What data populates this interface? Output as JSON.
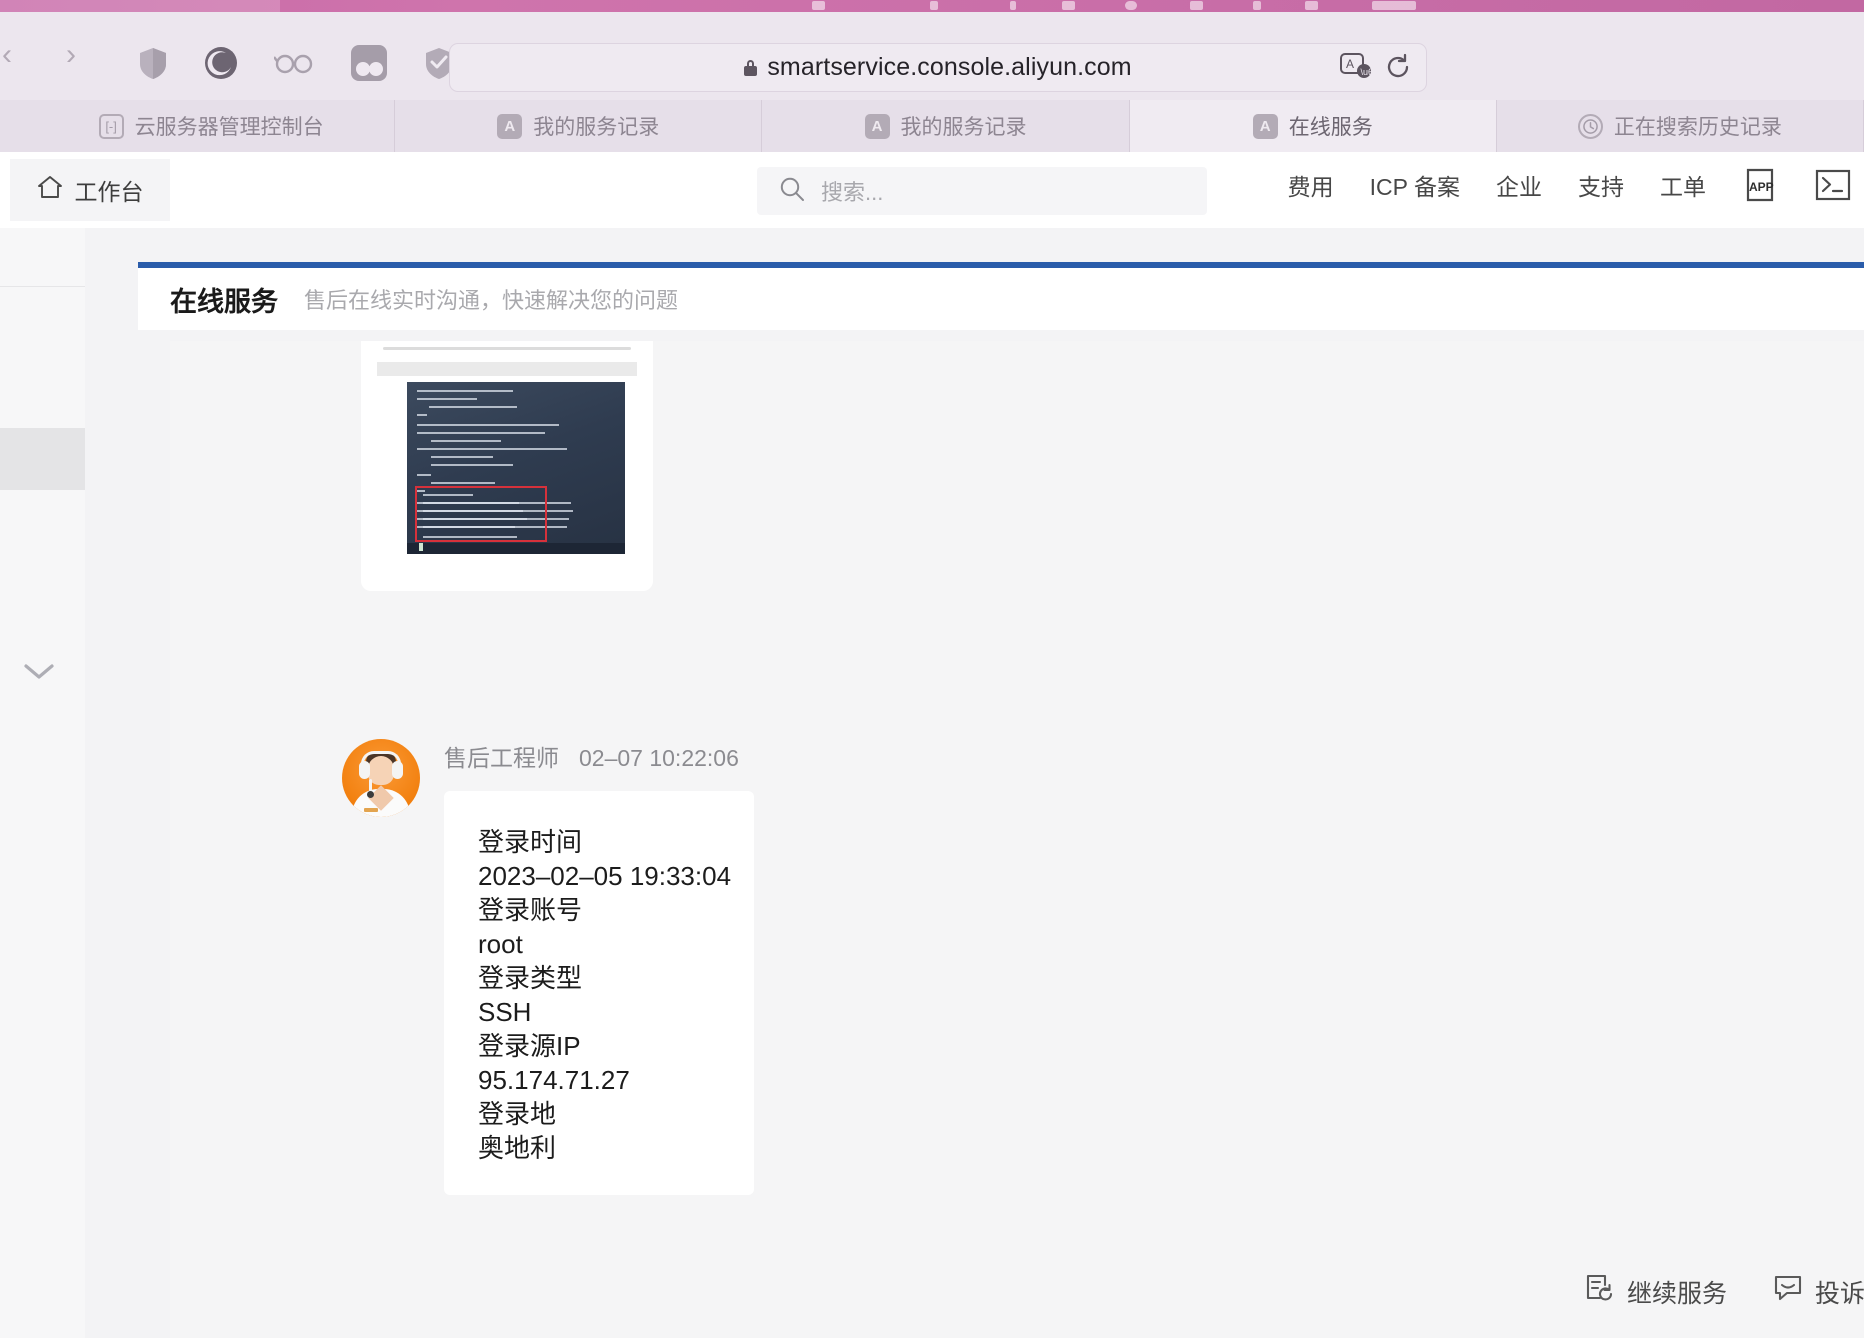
{
  "browser": {
    "url": "smartservice.console.aliyun.com",
    "toolbar_icons": [
      "shield-icon",
      "dark-mode-icon",
      "reader-glasses-icon",
      "extension-icon",
      "checkmark-shield-icon"
    ],
    "nav": {
      "back": "‹",
      "forward": "›"
    },
    "url_right_icons": [
      "translate-icon",
      "reload-icon"
    ],
    "tabs": [
      {
        "label": "云服务器管理控制台",
        "favicon": "[-]",
        "favicon_style": "outline",
        "active": false
      },
      {
        "label": "我的服务记录",
        "favicon": "A",
        "favicon_style": "solid",
        "active": false
      },
      {
        "label": "我的服务记录",
        "favicon": "A",
        "favicon_style": "solid",
        "active": false
      },
      {
        "label": "在线服务",
        "favicon": "A",
        "favicon_style": "solid",
        "active": true
      },
      {
        "label": "正在搜索历史记录",
        "favicon": "clock",
        "favicon_style": "outline",
        "active": false
      }
    ]
  },
  "console_header": {
    "workbench_label": "工作台",
    "home_icon": "home-icon",
    "search": {
      "placeholder": "搜索...",
      "value": "",
      "icon": "search-icon"
    },
    "links": [
      {
        "label": "费用"
      },
      {
        "label": "ICP 备案"
      },
      {
        "label": "企业"
      },
      {
        "label": "支持"
      },
      {
        "label": "工单"
      }
    ],
    "app_icon_label": "APP",
    "shell_icon": "terminal-icon"
  },
  "page": {
    "title": "在线服务",
    "subtitle": "售后在线实时沟通，快速解决您的问题",
    "accent_color": "#2a5caa"
  },
  "chat": {
    "attachment_message": {
      "type": "image-attachment",
      "alt": "terminal-screenshot"
    },
    "message": {
      "sender": "售后工程师",
      "timestamp": "02–07 10:22:06",
      "avatar": "support-engineer-avatar",
      "lines": [
        "登录时间",
        "2023–02–05 19:33:04",
        "登录账号",
        "root",
        "登录类型",
        "SSH",
        "登录源IP",
        "95.174.71.27",
        "登录地",
        "奥地利"
      ]
    }
  },
  "bottom_actions": [
    {
      "label": "继续服务",
      "icon": "continue-service-icon"
    },
    {
      "label": "投诉",
      "icon": "complaint-icon"
    }
  ],
  "sidebar": {
    "collapse_icon": "chevron-left-icon",
    "expand_icon": "chevron-down-icon"
  }
}
